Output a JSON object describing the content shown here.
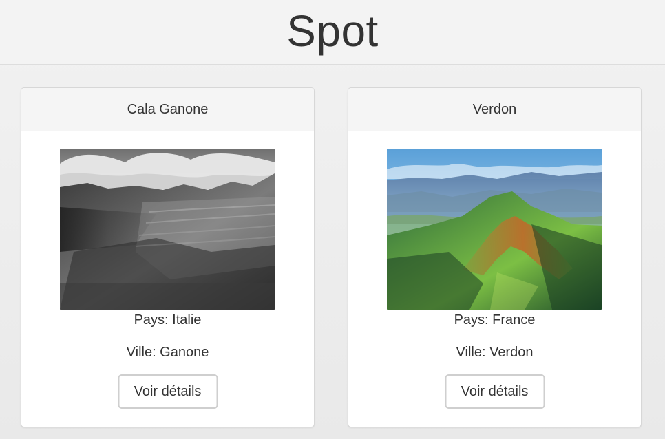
{
  "header": {
    "title": "Spot"
  },
  "cards": [
    {
      "title": "Cala Ganone",
      "pays": "Pays: Italie",
      "ville": "Ville: Ganone",
      "button_label": "Voir détails",
      "image": "mountain-bw-photo"
    },
    {
      "title": "Verdon",
      "pays": "Pays: France",
      "ville": "Ville: Verdon",
      "button_label": "Voir détails",
      "image": "mountain-aerial-color-photo"
    }
  ]
}
